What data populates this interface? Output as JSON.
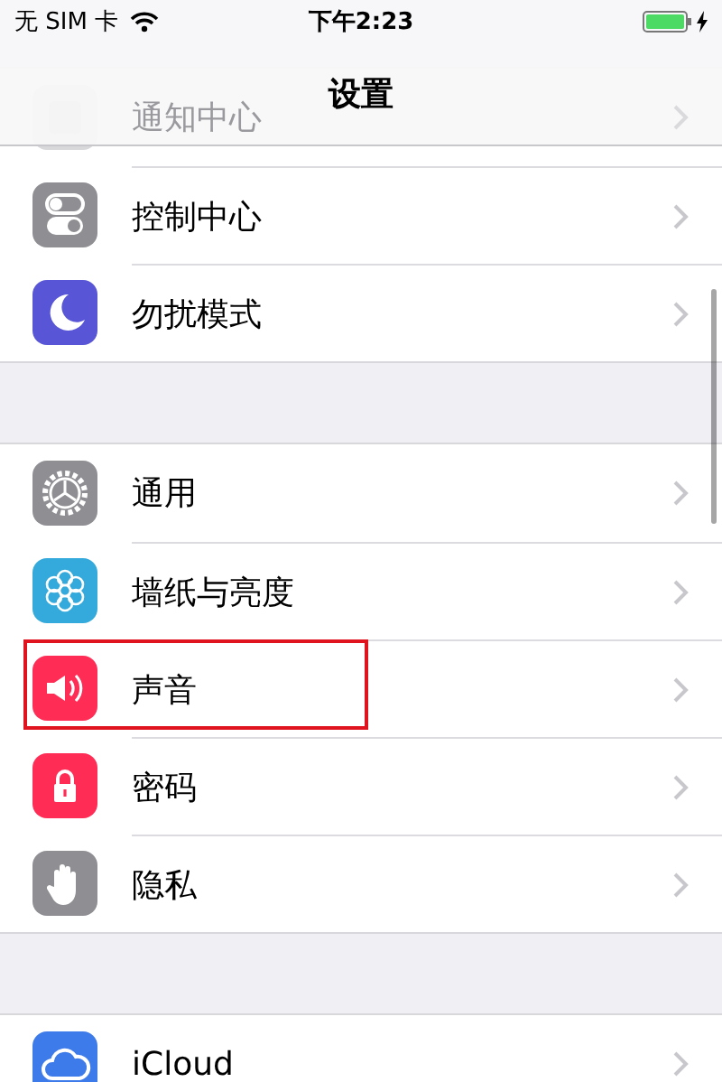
{
  "status_bar": {
    "carrier": "无 SIM 卡",
    "time": "下午2:23",
    "battery": {
      "level": 1,
      "charging": true
    }
  },
  "nav_bar": {
    "title": "设置"
  },
  "groups": [
    {
      "items": [
        {
          "label": "通知中心",
          "kind": "notifications",
          "highlighted": false,
          "dimmed": true
        },
        {
          "label": "控制中心",
          "kind": "control",
          "highlighted": false,
          "dimmed": false
        },
        {
          "label": "勿扰模式",
          "kind": "moon",
          "highlighted": false,
          "dimmed": false
        }
      ]
    },
    {
      "items": [
        {
          "label": "通用",
          "kind": "gear",
          "highlighted": false,
          "dimmed": false
        },
        {
          "label": "墙纸与亮度",
          "kind": "flower",
          "highlighted": false,
          "dimmed": false
        },
        {
          "label": "声音",
          "kind": "speaker",
          "highlighted": true,
          "dimmed": false
        },
        {
          "label": "密码",
          "kind": "lock",
          "highlighted": false,
          "dimmed": false
        },
        {
          "label": "隐私",
          "kind": "hand",
          "highlighted": false,
          "dimmed": false
        }
      ]
    },
    {
      "items": [
        {
          "label": "iCloud",
          "kind": "cloud",
          "highlighted": false,
          "dimmed": false
        }
      ]
    }
  ]
}
